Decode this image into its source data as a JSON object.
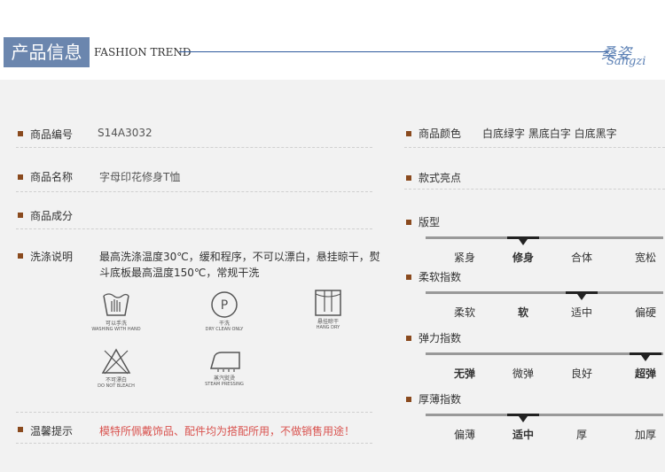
{
  "header": {
    "title": "产品信息",
    "subtitle": "FASHION TREND",
    "logo_cn": "桑姿",
    "logo_en": "Sangzi"
  },
  "left": {
    "code_label": "商品编号",
    "code_value": "S14A3032",
    "name_label": "商品名称",
    "name_value": "字母印花修身T恤",
    "material_label": "商品成分",
    "material_value": "",
    "wash_label": "洗涤说明",
    "wash_text": "最高洗涤温度30℃，缓和程序，不可以漂白，悬挂晾干，熨斗底板最高温度150℃，常规干洗",
    "icons": [
      {
        "name": "hand-wash-icon",
        "cn": "可以手洗",
        "en": "WASHING WITH HAND"
      },
      {
        "name": "dry-clean-icon",
        "cn": "干洗",
        "en": "DRY CLEAN ONLY"
      },
      {
        "name": "hang-dry-icon",
        "cn": "悬挂晾干",
        "en": "HANG DRY"
      },
      {
        "name": "no-bleach-icon",
        "cn": "不可漂白",
        "en": "DO NOT BLEACH"
      },
      {
        "name": "steam-iron-icon",
        "cn": "蒸汽熨烫",
        "en": "STEAM PRESSING"
      }
    ],
    "tip_label": "温馨提示",
    "tip_text": "模特所佩戴饰品、配件均为搭配所用，不做销售用途！"
  },
  "right": {
    "color_label": "商品颜色",
    "color_value": "白底绿字  黑底白字  白底黑字",
    "feature_label": "款式亮点",
    "scales": [
      {
        "label": "版型",
        "options": [
          "紧身",
          "修身",
          "合体",
          "宽松"
        ],
        "selected": 1
      },
      {
        "label": "柔软指数",
        "options": [
          "柔软",
          "软",
          "适中",
          "偏硬"
        ],
        "selected": 2
      },
      {
        "label": "弹力指数",
        "options": [
          "无弹",
          "微弹",
          "良好",
          "超弹"
        ],
        "selected": 3
      },
      {
        "label": "厚薄指数",
        "options": [
          "偏薄",
          "适中",
          "厚",
          "加厚"
        ],
        "selected": 1
      }
    ],
    "bold_options": [
      [
        1
      ],
      [
        1
      ],
      [
        0,
        3
      ],
      [
        1
      ]
    ]
  }
}
